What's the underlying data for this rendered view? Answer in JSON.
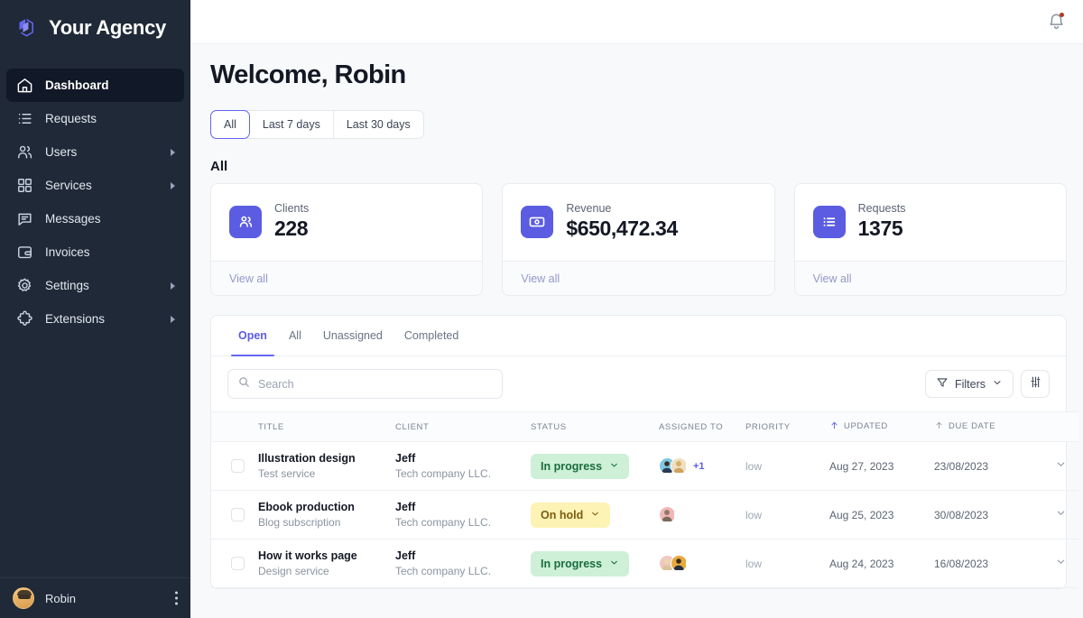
{
  "brand": {
    "name": "Your Agency",
    "logo_icon": "cube-logo-icon",
    "accent": "#5b5ce2"
  },
  "sidebar": {
    "items": [
      {
        "label": "Dashboard",
        "icon": "home-icon",
        "active": true,
        "caret": false
      },
      {
        "label": "Requests",
        "icon": "list-icon",
        "active": false,
        "caret": false
      },
      {
        "label": "Users",
        "icon": "users-icon",
        "active": false,
        "caret": true
      },
      {
        "label": "Services",
        "icon": "grid-icon",
        "active": false,
        "caret": true
      },
      {
        "label": "Messages",
        "icon": "chat-icon",
        "active": false,
        "caret": false
      },
      {
        "label": "Invoices",
        "icon": "wallet-icon",
        "active": false,
        "caret": false
      },
      {
        "label": "Settings",
        "icon": "gear-icon",
        "active": false,
        "caret": true
      },
      {
        "label": "Extensions",
        "icon": "puzzle-icon",
        "active": false,
        "caret": true
      }
    ],
    "footer": {
      "username": "Robin",
      "avatar": "user-avatar",
      "menu_icon": "kebab-menu-icon"
    }
  },
  "topbar": {
    "notifications_icon": "bell-icon",
    "has_unread": true,
    "unread_dot_color": "#b4371f"
  },
  "header": {
    "title": "Welcome, Robin"
  },
  "range_filter": {
    "options": [
      {
        "label": "All",
        "selected": true
      },
      {
        "label": "Last 7 days",
        "selected": false
      },
      {
        "label": "Last 30 days",
        "selected": false
      }
    ]
  },
  "stats": {
    "section_title": "All",
    "view_all_label": "View all",
    "cards": [
      {
        "label": "Clients",
        "value": "228",
        "icon": "clients-icon",
        "color": "#5b5ce2"
      },
      {
        "label": "Revenue",
        "value": "$650,472.34",
        "icon": "money-icon",
        "color": "#5b5ce2"
      },
      {
        "label": "Requests",
        "value": "1375",
        "icon": "requests-icon",
        "color": "#5b5ce2"
      }
    ]
  },
  "requests_panel": {
    "tabs": [
      {
        "label": "Open",
        "active": true
      },
      {
        "label": "All",
        "active": false
      },
      {
        "label": "Unassigned",
        "active": false
      },
      {
        "label": "Completed",
        "active": false
      }
    ],
    "search": {
      "value": "",
      "placeholder": "Search",
      "icon": "search-icon"
    },
    "filters_button": {
      "label": "Filters",
      "icon": "funnel-icon",
      "chevron": "chevron-down-icon"
    },
    "columns_button": {
      "icon": "sliders-icon"
    },
    "columns": [
      {
        "key": "checkbox",
        "label": ""
      },
      {
        "key": "title",
        "label": "TITLE"
      },
      {
        "key": "client",
        "label": "CLIENT"
      },
      {
        "key": "status",
        "label": "STATUS"
      },
      {
        "key": "assigned",
        "label": "ASSIGNED TO"
      },
      {
        "key": "priority",
        "label": "PRIORITY"
      },
      {
        "key": "updated",
        "label": "UPDATED",
        "sort_icon": "arrow-up-icon",
        "sort_active": true
      },
      {
        "key": "due",
        "label": "DUE DATE",
        "sort_icon": "arrow-up-icon",
        "sort_active": false
      },
      {
        "key": "expand",
        "label": ""
      }
    ],
    "rows": [
      {
        "checked": false,
        "title": "Illustration design",
        "subtitle": "Test service",
        "client": "Jeff",
        "client_company": "Tech company LLC.",
        "status": "In progress",
        "status_tone": "green",
        "assignees": 2,
        "assignee_more": "+1",
        "priority": "low",
        "updated": "Aug 27, 2023",
        "due": "23/08/2023"
      },
      {
        "checked": false,
        "title": "Ebook production",
        "subtitle": "Blog subscription",
        "client": "Jeff",
        "client_company": "Tech company LLC.",
        "status": "On hold",
        "status_tone": "yellow",
        "assignees": 1,
        "assignee_more": "",
        "priority": "low",
        "updated": "Aug 25, 2023",
        "due": "30/08/2023"
      },
      {
        "checked": false,
        "title": "How it works page",
        "subtitle": "Design service",
        "client": "Jeff",
        "client_company": "Tech company LLC.",
        "status": "In progress",
        "status_tone": "green",
        "assignees": 2,
        "assignee_more": "",
        "priority": "low",
        "updated": "Aug 24, 2023",
        "due": "16/08/2023"
      }
    ]
  }
}
